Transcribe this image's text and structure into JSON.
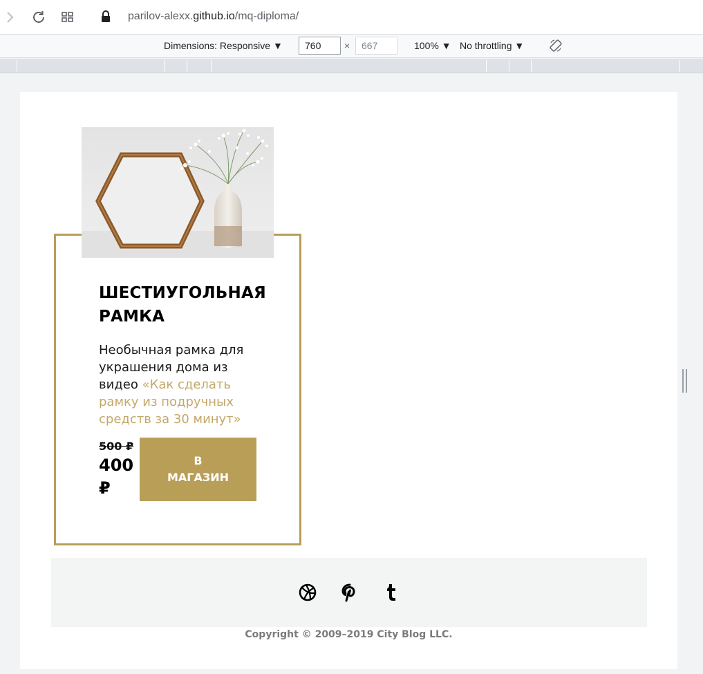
{
  "browser": {
    "url_prefix": "parilov-alexx.",
    "url_host": "github.io",
    "url_path": "/mq-diploma/"
  },
  "devtools": {
    "dimensions_label": "Dimensions: Responsive ▼",
    "width_value": "760",
    "height_placeholder": "667",
    "times": "×",
    "zoom_label": "100% ▼",
    "throttling_label": "No throttling ▼"
  },
  "product": {
    "title": "ШЕСТИУГОЛЬНАЯ РАМКА",
    "description": "Необычная рамка для украшения дома из видео ",
    "link_text": "«Как сделать рамку из подручных средств за 30 минут»",
    "old_price": "500 ₽",
    "new_price": "400 ₽",
    "button_label": "В МАГАЗИН"
  },
  "footer": {
    "social_icons": [
      "dribbble-icon",
      "pinterest-icon",
      "tumblr-icon"
    ],
    "copyright": "Copyright © 2009–2019 City Blog LLC."
  },
  "colors": {
    "accent": "#b89e57",
    "link": "#c4a868",
    "footer_bg": "#f3f4f4"
  }
}
